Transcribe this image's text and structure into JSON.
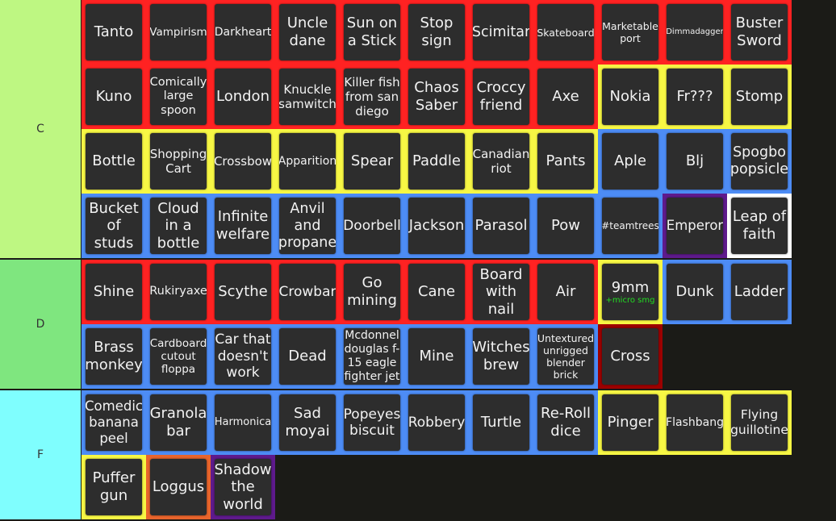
{
  "tiers": [
    {
      "label": "C",
      "color": "#bef782",
      "items": [
        {
          "text": "Tanto",
          "border": "#ff2222"
        },
        {
          "text": "Vampirism",
          "border": "#ff2222"
        },
        {
          "text": "Darkheart",
          "border": "#ff2222"
        },
        {
          "text": "Uncle dane",
          "border": "#ff2222"
        },
        {
          "text": "Sun on a Stick",
          "border": "#ff2222"
        },
        {
          "text": "Stop sign",
          "border": "#ff2222"
        },
        {
          "text": "Scimitar",
          "border": "#ff2222"
        },
        {
          "text": "Skateboard",
          "border": "#ff2222"
        },
        {
          "text": "Marketable port",
          "border": "#ff2222"
        },
        {
          "text": "Dimmadagger",
          "border": "#ff2222"
        },
        {
          "text": "Buster Sword",
          "border": "#ff2222"
        },
        {
          "text": "Kuno",
          "border": "#ff2222"
        },
        {
          "text": "Comically large spoon",
          "border": "#ff2222"
        },
        {
          "text": "London",
          "border": "#ff2222"
        },
        {
          "text": "Knuckle samwitch",
          "border": "#ff2222"
        },
        {
          "text": "Killer fish from san diego",
          "border": "#ff2222"
        },
        {
          "text": "Chaos Saber",
          "border": "#ff2222"
        },
        {
          "text": "Croccy friend",
          "border": "#ff2222"
        },
        {
          "text": "Axe",
          "border": "#ff2222"
        },
        {
          "text": "Nokia",
          "border": "#f7f744"
        },
        {
          "text": "Fr???",
          "border": "#f7f744"
        },
        {
          "text": "Stomp",
          "border": "#f7f744"
        },
        {
          "text": "Bottle",
          "border": "#f7f744"
        },
        {
          "text": "Shopping Cart",
          "border": "#f7f744"
        },
        {
          "text": "Crossbow",
          "border": "#f7f744"
        },
        {
          "text": "Apparition",
          "border": "#f7f744"
        },
        {
          "text": "Spear",
          "border": "#f7f744"
        },
        {
          "text": "Paddle",
          "border": "#f7f744"
        },
        {
          "text": "Canadian riot",
          "border": "#f7f744"
        },
        {
          "text": "Pants",
          "border": "#f7f744"
        },
        {
          "text": "Aple",
          "border": "#4d8cf5"
        },
        {
          "text": "Blj",
          "border": "#4d8cf5"
        },
        {
          "text": "Spogbo popsicle",
          "border": "#4d8cf5"
        },
        {
          "text": "Bucket of studs",
          "border": "#4d8cf5"
        },
        {
          "text": "Cloud in a bottle",
          "border": "#4d8cf5"
        },
        {
          "text": "Infinite welfare",
          "border": "#4d8cf5"
        },
        {
          "text": "Anvil and propane",
          "border": "#4d8cf5"
        },
        {
          "text": "Doorbell",
          "border": "#4d8cf5"
        },
        {
          "text": "Jackson",
          "border": "#4d8cf5"
        },
        {
          "text": "Parasol",
          "border": "#4d8cf5"
        },
        {
          "text": "Pow",
          "border": "#4d8cf5"
        },
        {
          "text": "#teamtrees",
          "border": "#4d8cf5"
        },
        {
          "text": "Emperor",
          "border": "#5e1a8c"
        },
        {
          "text": "Leap of faith",
          "border": "#ffffff"
        }
      ]
    },
    {
      "label": "D",
      "color": "#7fe67f",
      "items": [
        {
          "text": "Shine",
          "border": "#ff2222"
        },
        {
          "text": "Rukiryaxe",
          "border": "#ff2222"
        },
        {
          "text": "Scythe",
          "border": "#ff2222"
        },
        {
          "text": "Crowbar",
          "border": "#ff2222"
        },
        {
          "text": "Go mining",
          "border": "#ff2222"
        },
        {
          "text": "Cane",
          "border": "#ff2222"
        },
        {
          "text": "Board with nail",
          "border": "#ff2222"
        },
        {
          "text": "Air",
          "border": "#ff2222"
        },
        {
          "text": "9mm",
          "sub": "+micro smg",
          "border": "#f7f744"
        },
        {
          "text": "Dunk",
          "border": "#4d8cf5"
        },
        {
          "text": "Ladder",
          "border": "#4d8cf5"
        },
        {
          "text": "Brass monkey",
          "border": "#4d8cf5"
        },
        {
          "text": "Cardboard cutout floppa",
          "border": "#4d8cf5"
        },
        {
          "text": "Car that doesn't work",
          "border": "#4d8cf5"
        },
        {
          "text": "Dead",
          "border": "#4d8cf5"
        },
        {
          "text": "Mcdonnel douglas f-15 eagle fighter jet",
          "border": "#4d8cf5"
        },
        {
          "text": "Mine",
          "border": "#4d8cf5"
        },
        {
          "text": "Witches brew",
          "border": "#4d8cf5"
        },
        {
          "text": "Untextured unrigged blender brick",
          "border": "#4d8cf5"
        },
        {
          "text": "Cross",
          "border": "#9c0000"
        }
      ]
    },
    {
      "label": "F",
      "color": "#7ffefe",
      "items": [
        {
          "text": "Comedic banana peel",
          "border": "#4d8cf5"
        },
        {
          "text": "Granola bar",
          "border": "#4d8cf5"
        },
        {
          "text": "Harmonica",
          "border": "#4d8cf5"
        },
        {
          "text": "Sad moyai",
          "border": "#4d8cf5"
        },
        {
          "text": "Popeyes biscuit",
          "border": "#4d8cf5"
        },
        {
          "text": "Robbery",
          "border": "#4d8cf5"
        },
        {
          "text": "Turtle",
          "border": "#4d8cf5"
        },
        {
          "text": "Re-Roll dice",
          "border": "#4d8cf5"
        },
        {
          "text": "Pinger",
          "border": "#f7f744"
        },
        {
          "text": "Flashbang",
          "border": "#f7f744"
        },
        {
          "text": "Flying guillotine",
          "border": "#f7f744"
        },
        {
          "text": "Puffer gun",
          "border": "#f7f744"
        },
        {
          "text": "Loggus",
          "border": "#e8642c"
        },
        {
          "text": "Shadow the world",
          "border": "#5e1a8c"
        }
      ]
    }
  ]
}
